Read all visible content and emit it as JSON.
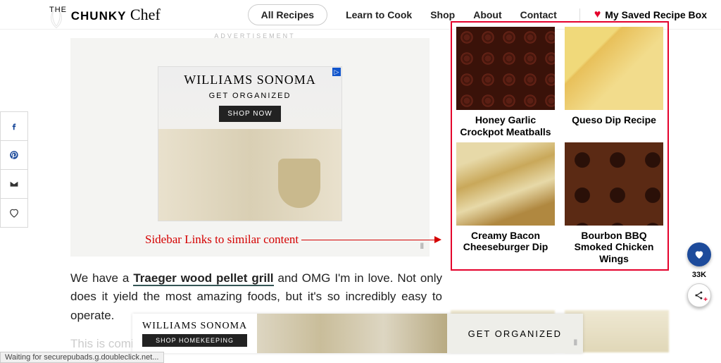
{
  "logo": {
    "the": "THE",
    "bold": "CHUNKY",
    "script": "Chef"
  },
  "nav": {
    "all_recipes": "All Recipes",
    "learn": "Learn to Cook",
    "shop": "Shop",
    "about": "About",
    "contact": "Contact",
    "saved": "My Saved Recipe Box"
  },
  "ad_label": "ADVERTISEMENT",
  "ws_ad": {
    "title": "WILLIAMS SONOMA",
    "sub": "GET ORGANIZED",
    "btn": "SHOP NOW"
  },
  "annotation": "Sidebar Links to similar content",
  "article": {
    "p1_a": "We have a ",
    "p1_link": "Traeger wood pellet grill",
    "p1_b": " and OMG I'm in love.  Not only does it yield the most amazing foods, but it's so incredibly easy to operate.",
    "p2": "This is comi"
  },
  "sidebar": {
    "cards": [
      {
        "title": "Honey Garlic Crockpot Meatballs"
      },
      {
        "title": "Queso Dip Recipe"
      },
      {
        "title": "Creamy Bacon Cheeseburger Dip"
      },
      {
        "title": "Bourbon BBQ Smoked Chicken Wings"
      }
    ]
  },
  "float": {
    "count": "33K"
  },
  "bottom": {
    "title": "WILLIAMS SONOMA",
    "btn": "SHOP HOMEKEEPING",
    "right": "GET ORGANIZED"
  },
  "status": "Waiting for securepubads.g.doubleclick.net..."
}
